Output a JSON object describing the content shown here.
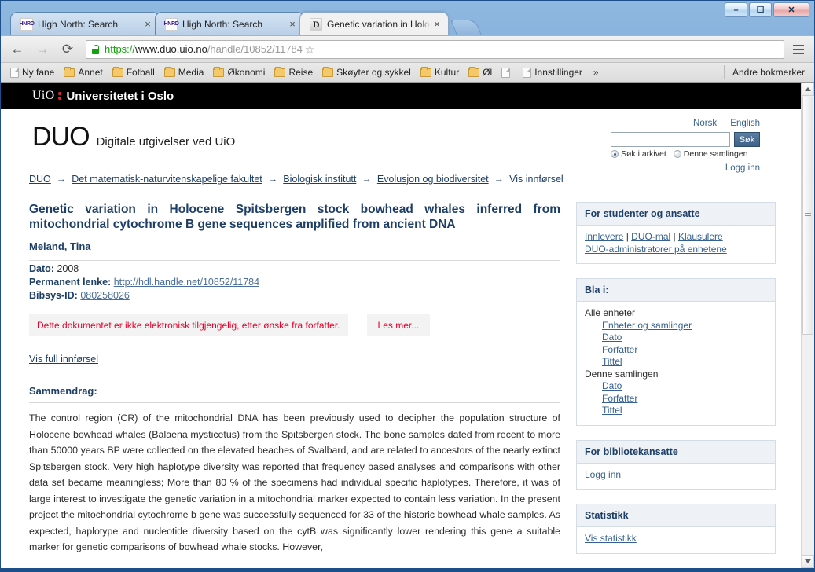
{
  "browser": {
    "tabs": [
      {
        "title": "High North: Search",
        "favicon": "hnrd-favicon",
        "active": false
      },
      {
        "title": "High North: Search",
        "favicon": "hnrd-favicon",
        "active": false
      },
      {
        "title": "Genetic variation in Holoc",
        "favicon": "duo-favicon",
        "active": true
      }
    ],
    "close_label": "×",
    "new_tab_label": "",
    "window_buttons": {
      "minimize": "–",
      "maximize": "❐",
      "close": "✕"
    },
    "nav": {
      "back": "←",
      "forward": "→",
      "reload": "C"
    },
    "omnibox": {
      "lock_icon": "https-lock-icon",
      "scheme": "https://",
      "host": "www.duo.uio.no",
      "path": "/handle/10852/11784",
      "star_icon": "☆"
    },
    "menu_icon": "hamburger-menu-icon",
    "bookmarks": [
      {
        "label": "Ny fane",
        "type": "page"
      },
      {
        "label": "Annet",
        "type": "folder"
      },
      {
        "label": "Fotball",
        "type": "folder"
      },
      {
        "label": "Media",
        "type": "folder"
      },
      {
        "label": "Økonomi",
        "type": "folder"
      },
      {
        "label": "Reise",
        "type": "folder"
      },
      {
        "label": "Skøyter og sykkel",
        "type": "folder"
      },
      {
        "label": "Kultur",
        "type": "folder"
      },
      {
        "label": "Øl",
        "type": "folder"
      },
      {
        "label": "",
        "type": "page"
      },
      {
        "label": "Innstillinger",
        "type": "page"
      }
    ],
    "bookmarks_overflow": "»",
    "other_bookmarks": "Andre bokmerker"
  },
  "site": {
    "uio_bar": {
      "uio": "UiO",
      "university": "Universitetet i Oslo"
    },
    "logo": "DUO",
    "tagline": "Digitale utgivelser ved UiO",
    "lang": {
      "norsk": "Norsk",
      "english": "English"
    },
    "search": {
      "value": "",
      "placeholder": "",
      "button": "Søk",
      "scope_archive": "Søk i arkivet",
      "scope_collection": "Denne samlingen",
      "selected_scope": "Søk i arkivet"
    },
    "login": "Logg inn",
    "breadcrumb": [
      {
        "label": "DUO",
        "link": true
      },
      {
        "label": "Det matematisk-naturvitenskapelige fakultet",
        "link": true
      },
      {
        "label": "Biologisk institutt",
        "link": true
      },
      {
        "label": "Evolusjon og biodiversitet",
        "link": true
      },
      {
        "label": "Vis innførsel",
        "link": false
      }
    ],
    "breadcrumb_separator": "→"
  },
  "record": {
    "title": "Genetic variation in Holocene Spitsbergen stock bowhead whales inferred from mitochondrial cytochrome B gene sequences amplified from ancient DNA",
    "author": "Meland, Tina",
    "date_label": "Dato:",
    "date_value": "2008",
    "permalink_label": "Permanent lenke:",
    "permalink_value": "http://hdl.handle.net/10852/11784",
    "bibsys_label": "Bibsys-ID:",
    "bibsys_value": "080258026",
    "notice": "Dette dokumentet er ikke elektronisk tilgjengelig, etter ønske fra forfatter.",
    "read_more": "Les mer...",
    "full_record": "Vis full innførsel",
    "abstract_label": "Sammendrag:",
    "abstract": "The control region (CR) of the mitochondrial DNA has been previously used to decipher the population structure of Holocene bowhead whales (Balaena mysticetus) from the Spitsbergen stock. The bone samples dated from recent to more than 50000 years BP were collected on the elevated beaches of Svalbard, and are related to ancestors of the nearly extinct Spitsbergen stock. Very high haplotype diversity was reported that frequency based analyses and comparisons with other data set became meaningless; More than 80 % of the specimens had individual specific haplotypes. Therefore, it was of large interest to investigate the genetic variation in a mitochondrial marker expected to contain less variation. In the present project the mitochondrial cytochrome b gene was successfully sequenced for 33 of the historic bowhead whale samples. As expected, haplotype and nucleotide diversity based on the cytB was significantly lower rendering this gene a suitable marker for genetic comparisons of bowhead whale stocks. However,"
  },
  "sidebar": {
    "students": {
      "heading": "For studenter og ansatte",
      "links_line1": [
        "Innlevere",
        "DUO-mal",
        "Klausulere"
      ],
      "separator": " | ",
      "links_line2": [
        "DUO-administratorer på enhetene"
      ]
    },
    "browse": {
      "heading": "Bla i:",
      "group1_label": "Alle enheter",
      "group1_items": [
        "Enheter og samlinger",
        "Dato",
        "Forfatter",
        "Tittel"
      ],
      "group2_label": "Denne samlingen",
      "group2_items": [
        "Dato",
        "Forfatter",
        "Tittel"
      ]
    },
    "library": {
      "heading": "For bibliotekansatte",
      "link": "Logg inn"
    },
    "stats": {
      "heading": "Statistikk",
      "link": "Vis statistikk"
    }
  },
  "colors": {
    "uio_red": "#e02b20",
    "link_blue": "#1d3e66",
    "sidebar_heading_bg": "#eef2f6",
    "notice_red": "#e8002a",
    "chrome_blue": "#6f9fd0"
  }
}
